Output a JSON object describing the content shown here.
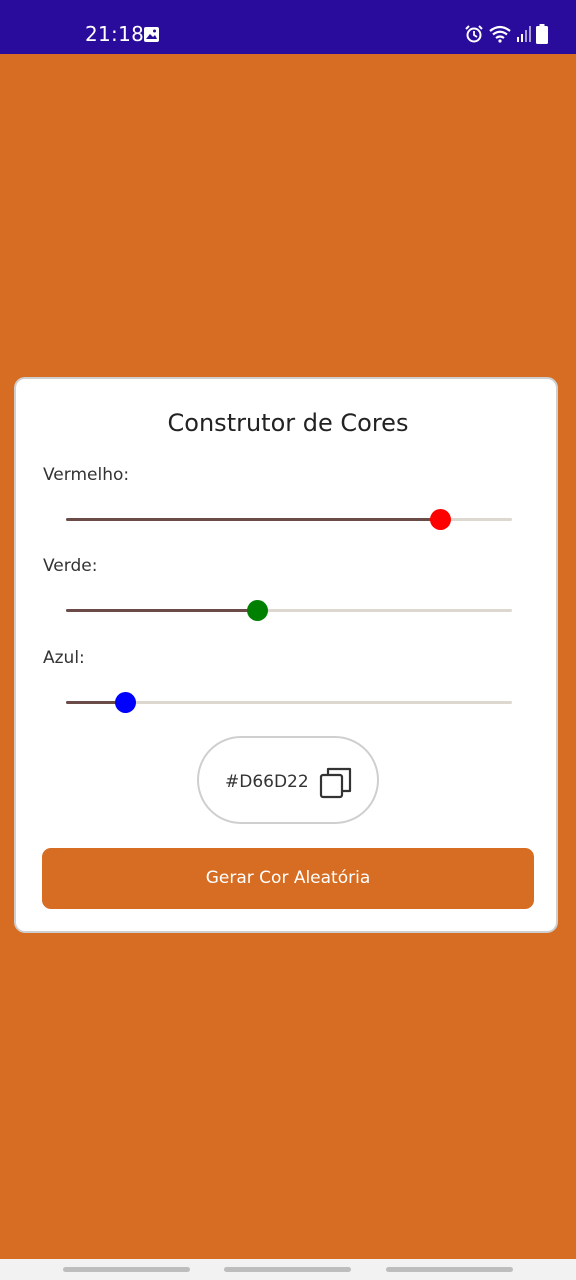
{
  "status_bar": {
    "time": "21:18",
    "icons": [
      "gallery-icon",
      "alarm-icon",
      "wifi-icon",
      "signal-icon",
      "battery-icon"
    ],
    "background": "#2A0C9C"
  },
  "app": {
    "background": "#D66D22",
    "title": "Construtor de Cores",
    "sliders": [
      {
        "label": "Vermelho:",
        "value": 214,
        "max": 255,
        "thumb_color": "#FF0000"
      },
      {
        "label": "Verde:",
        "value": 109,
        "max": 255,
        "thumb_color": "#008000"
      },
      {
        "label": "Azul:",
        "value": 34,
        "max": 255,
        "thumb_color": "#0000FF"
      }
    ],
    "hex_value": "#D66D22",
    "copy_icon": "copy-icon",
    "random_button_label": "Gerar Cor Aleatória"
  },
  "nav_bar": {
    "handles": [
      "recent-apps-handle",
      "home-handle",
      "back-handle"
    ]
  }
}
